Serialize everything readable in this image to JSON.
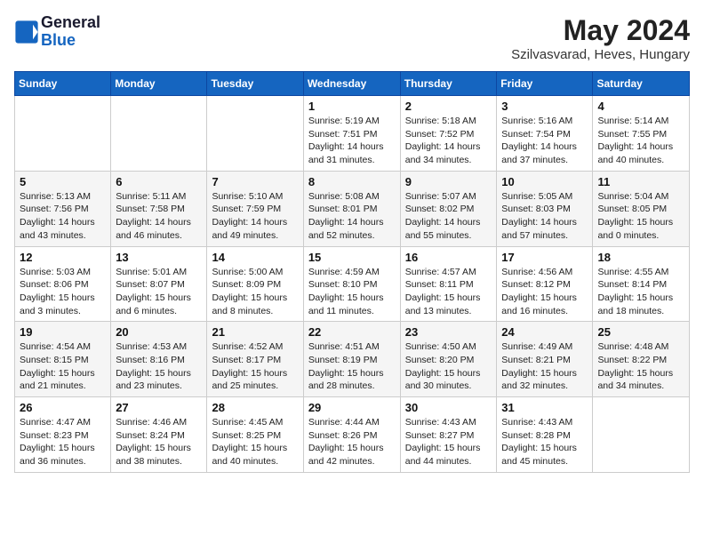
{
  "header": {
    "logo_line1": "General",
    "logo_line2": "Blue",
    "month_title": "May 2024",
    "location": "Szilvasvarad, Heves, Hungary"
  },
  "weekdays": [
    "Sunday",
    "Monday",
    "Tuesday",
    "Wednesday",
    "Thursday",
    "Friday",
    "Saturday"
  ],
  "weeks": [
    [
      {
        "day": "",
        "info": ""
      },
      {
        "day": "",
        "info": ""
      },
      {
        "day": "",
        "info": ""
      },
      {
        "day": "1",
        "info": "Sunrise: 5:19 AM\nSunset: 7:51 PM\nDaylight: 14 hours\nand 31 minutes."
      },
      {
        "day": "2",
        "info": "Sunrise: 5:18 AM\nSunset: 7:52 PM\nDaylight: 14 hours\nand 34 minutes."
      },
      {
        "day": "3",
        "info": "Sunrise: 5:16 AM\nSunset: 7:54 PM\nDaylight: 14 hours\nand 37 minutes."
      },
      {
        "day": "4",
        "info": "Sunrise: 5:14 AM\nSunset: 7:55 PM\nDaylight: 14 hours\nand 40 minutes."
      }
    ],
    [
      {
        "day": "5",
        "info": "Sunrise: 5:13 AM\nSunset: 7:56 PM\nDaylight: 14 hours\nand 43 minutes."
      },
      {
        "day": "6",
        "info": "Sunrise: 5:11 AM\nSunset: 7:58 PM\nDaylight: 14 hours\nand 46 minutes."
      },
      {
        "day": "7",
        "info": "Sunrise: 5:10 AM\nSunset: 7:59 PM\nDaylight: 14 hours\nand 49 minutes."
      },
      {
        "day": "8",
        "info": "Sunrise: 5:08 AM\nSunset: 8:01 PM\nDaylight: 14 hours\nand 52 minutes."
      },
      {
        "day": "9",
        "info": "Sunrise: 5:07 AM\nSunset: 8:02 PM\nDaylight: 14 hours\nand 55 minutes."
      },
      {
        "day": "10",
        "info": "Sunrise: 5:05 AM\nSunset: 8:03 PM\nDaylight: 14 hours\nand 57 minutes."
      },
      {
        "day": "11",
        "info": "Sunrise: 5:04 AM\nSunset: 8:05 PM\nDaylight: 15 hours\nand 0 minutes."
      }
    ],
    [
      {
        "day": "12",
        "info": "Sunrise: 5:03 AM\nSunset: 8:06 PM\nDaylight: 15 hours\nand 3 minutes."
      },
      {
        "day": "13",
        "info": "Sunrise: 5:01 AM\nSunset: 8:07 PM\nDaylight: 15 hours\nand 6 minutes."
      },
      {
        "day": "14",
        "info": "Sunrise: 5:00 AM\nSunset: 8:09 PM\nDaylight: 15 hours\nand 8 minutes."
      },
      {
        "day": "15",
        "info": "Sunrise: 4:59 AM\nSunset: 8:10 PM\nDaylight: 15 hours\nand 11 minutes."
      },
      {
        "day": "16",
        "info": "Sunrise: 4:57 AM\nSunset: 8:11 PM\nDaylight: 15 hours\nand 13 minutes."
      },
      {
        "day": "17",
        "info": "Sunrise: 4:56 AM\nSunset: 8:12 PM\nDaylight: 15 hours\nand 16 minutes."
      },
      {
        "day": "18",
        "info": "Sunrise: 4:55 AM\nSunset: 8:14 PM\nDaylight: 15 hours\nand 18 minutes."
      }
    ],
    [
      {
        "day": "19",
        "info": "Sunrise: 4:54 AM\nSunset: 8:15 PM\nDaylight: 15 hours\nand 21 minutes."
      },
      {
        "day": "20",
        "info": "Sunrise: 4:53 AM\nSunset: 8:16 PM\nDaylight: 15 hours\nand 23 minutes."
      },
      {
        "day": "21",
        "info": "Sunrise: 4:52 AM\nSunset: 8:17 PM\nDaylight: 15 hours\nand 25 minutes."
      },
      {
        "day": "22",
        "info": "Sunrise: 4:51 AM\nSunset: 8:19 PM\nDaylight: 15 hours\nand 28 minutes."
      },
      {
        "day": "23",
        "info": "Sunrise: 4:50 AM\nSunset: 8:20 PM\nDaylight: 15 hours\nand 30 minutes."
      },
      {
        "day": "24",
        "info": "Sunrise: 4:49 AM\nSunset: 8:21 PM\nDaylight: 15 hours\nand 32 minutes."
      },
      {
        "day": "25",
        "info": "Sunrise: 4:48 AM\nSunset: 8:22 PM\nDaylight: 15 hours\nand 34 minutes."
      }
    ],
    [
      {
        "day": "26",
        "info": "Sunrise: 4:47 AM\nSunset: 8:23 PM\nDaylight: 15 hours\nand 36 minutes."
      },
      {
        "day": "27",
        "info": "Sunrise: 4:46 AM\nSunset: 8:24 PM\nDaylight: 15 hours\nand 38 minutes."
      },
      {
        "day": "28",
        "info": "Sunrise: 4:45 AM\nSunset: 8:25 PM\nDaylight: 15 hours\nand 40 minutes."
      },
      {
        "day": "29",
        "info": "Sunrise: 4:44 AM\nSunset: 8:26 PM\nDaylight: 15 hours\nand 42 minutes."
      },
      {
        "day": "30",
        "info": "Sunrise: 4:43 AM\nSunset: 8:27 PM\nDaylight: 15 hours\nand 44 minutes."
      },
      {
        "day": "31",
        "info": "Sunrise: 4:43 AM\nSunset: 8:28 PM\nDaylight: 15 hours\nand 45 minutes."
      },
      {
        "day": "",
        "info": ""
      }
    ]
  ]
}
